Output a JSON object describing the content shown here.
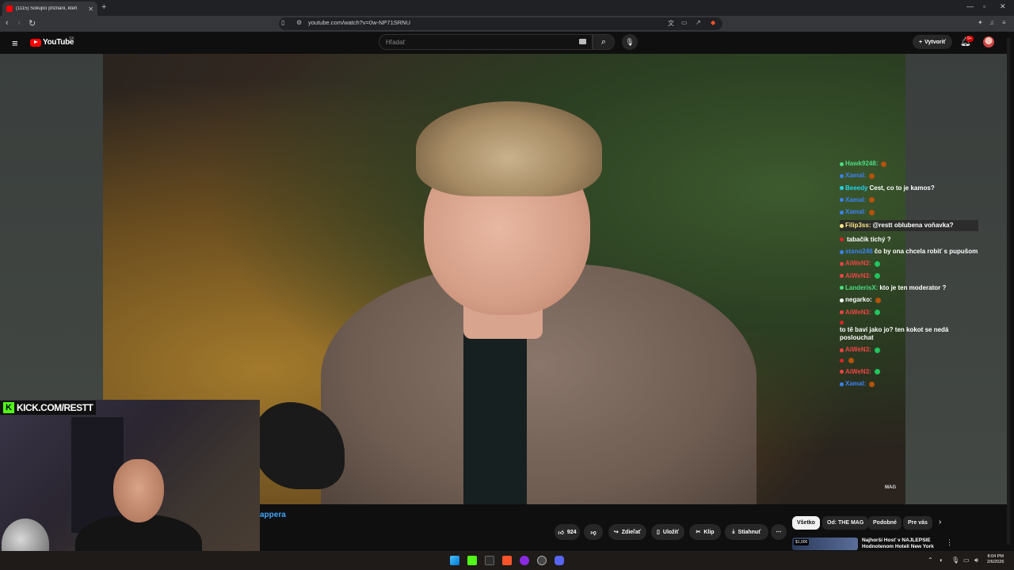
{
  "browser": {
    "tab_title": "(1115) Šokující přiznání, kteří",
    "url": "youtube.com/watch?v=0w-NP71SRNU"
  },
  "youtube": {
    "brand": "YouTube",
    "country_code": "SK",
    "search_placeholder": "Hľadať",
    "create_label": "Vytvoriť",
    "notif_count": "9+"
  },
  "video": {
    "watermark": "MAG",
    "title_fragment": "appera"
  },
  "chat": [
    {
      "user": "Hawk9248:",
      "text": "",
      "user_color": "#4ade80",
      "highlight": false
    },
    {
      "user": "Xamal:",
      "text": "",
      "user_color": "#3b82f6",
      "highlight": false
    },
    {
      "user": "Beeedy",
      "text": "Cest, co to je kamos?",
      "user_color": "#22d3ee",
      "highlight": false
    },
    {
      "user": "Xamal:",
      "text": "",
      "user_color": "#3b82f6",
      "highlight": false
    },
    {
      "user": "Xamal:",
      "text": "",
      "user_color": "#3b82f6",
      "highlight": false
    },
    {
      "user": "Filip3ss:",
      "text": "@restt oblubena voňavka?",
      "user_color": "#fde68a",
      "highlight": true
    },
    {
      "user": "",
      "text": "tabačik tichý ?",
      "user_color": "#dc2626",
      "highlight": false
    },
    {
      "user": "stano246",
      "text": "čo by ona chcela robiť s pupušom",
      "user_color": "#3b82f6",
      "highlight": false
    },
    {
      "user": "AiWeN3:",
      "text": "",
      "user_color": "#ef4444",
      "highlight": false
    },
    {
      "user": "AiWeN3:",
      "text": "",
      "user_color": "#ef4444",
      "highlight": false
    },
    {
      "user": "LanderisX:",
      "text": "kto je ten moderator ?",
      "user_color": "#4ade80",
      "highlight": false
    },
    {
      "user": "negarko:",
      "text": "",
      "user_color": "#ffffff",
      "highlight": false
    },
    {
      "user": "AiWeN3:",
      "text": "",
      "user_color": "#ef4444",
      "highlight": false
    },
    {
      "user": "",
      "text": "to tě baví jako jo? ten kokot se nedá poslouchat",
      "user_color": "#dc2626",
      "highlight": false
    },
    {
      "user": "AiWeN3:",
      "text": "",
      "user_color": "#ef4444",
      "highlight": false
    },
    {
      "user": "",
      "text": "",
      "user_color": "#dc2626",
      "highlight": false
    },
    {
      "user": "AiWeN3:",
      "text": "",
      "user_color": "#ef4444",
      "highlight": false
    },
    {
      "user": "Xamal:",
      "text": "",
      "user_color": "#3b82f6",
      "highlight": false
    }
  ],
  "overlay": {
    "kick_letter": "K",
    "kick_text": "KICK.COM/RESTT"
  },
  "actions": {
    "likes": "924",
    "share": "Zdieľať",
    "save": "Uložiť",
    "clip": "Klip",
    "download": "Stiahnuť"
  },
  "chips": [
    "Všetko",
    "Od: THE MAG",
    "Podobné",
    "Pre vás"
  ],
  "recommendation": {
    "badge": "$1,000",
    "title": "Najhorší Hosť v NAJLEPŠIE Hodnotenom Hoteli New York"
  },
  "taskbar": {
    "time": "8:04 PM",
    "date": "2/6/2026"
  }
}
